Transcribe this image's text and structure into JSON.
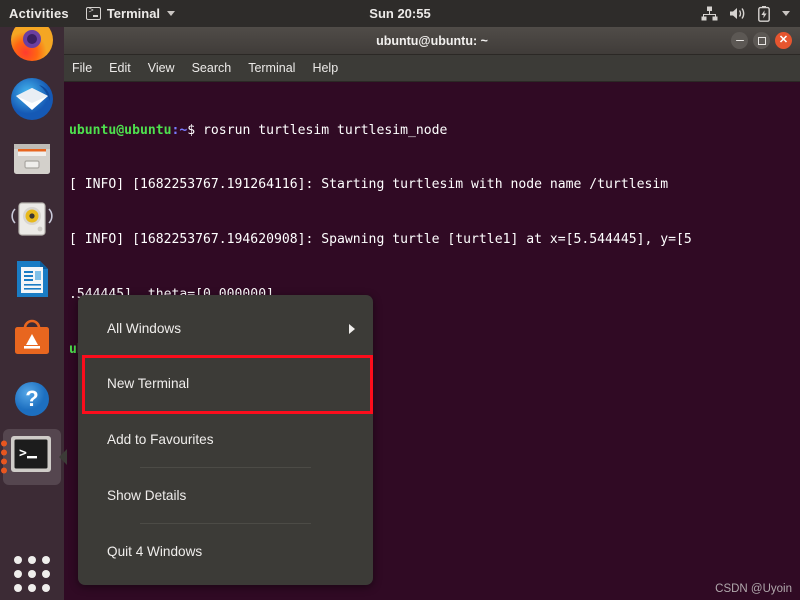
{
  "topbar": {
    "activities": "Activities",
    "app_icon": "terminal-icon",
    "app_name": "Terminal",
    "chevron": "chevron-down-icon",
    "clock": "Sun 20:55",
    "indicators": [
      "network-icon",
      "volume-icon",
      "battery-icon",
      "chevron-down-icon"
    ]
  },
  "dock": {
    "items": [
      {
        "name": "firefox",
        "label": "Firefox"
      },
      {
        "name": "thunderbird",
        "label": "Thunderbird Mail"
      },
      {
        "name": "files",
        "label": "Files"
      },
      {
        "name": "rhythmbox",
        "label": "Rhythmbox"
      },
      {
        "name": "libreoffice-writer",
        "label": "LibreOffice Writer"
      },
      {
        "name": "ubuntu-software",
        "label": "Ubuntu Software"
      },
      {
        "name": "help",
        "label": "Help"
      },
      {
        "name": "terminal",
        "label": "Terminal",
        "running": true,
        "window_count": 4,
        "selected": true
      }
    ],
    "show_applications": "Show Applications"
  },
  "window": {
    "title": "ubuntu@ubuntu: ~",
    "controls": {
      "minimize": "minimize-button",
      "maximize": "maximize-button",
      "close": "close-button"
    },
    "menubar": [
      "File",
      "Edit",
      "View",
      "Search",
      "Terminal",
      "Help"
    ],
    "terminal": {
      "prompt_user": "ubuntu@ubuntu",
      "prompt_path": ":~",
      "prompt_symbol": "$",
      "command": " rosrun turtlesim turtlesim_node",
      "lines": [
        "[ INFO] [1682253767.191264116]: Starting turtlesim with node name /turtlesim",
        "[ INFO] [1682253767.194620908]: Spawning turtle [turtle1] at x=[5.544445], y=[5",
        ".544445], theta=[0.000000]"
      ]
    }
  },
  "context_menu": {
    "items": [
      {
        "label": "All Windows",
        "has_submenu": true
      },
      {
        "label": "New Terminal",
        "highlighted": true
      },
      {
        "label": "Add to Favourites"
      },
      {
        "label": "Show Details"
      },
      {
        "label": "Quit 4 Windows"
      }
    ]
  },
  "highlight": {
    "color": "#fc0d1c"
  },
  "watermark": "CSDN @Uyoin",
  "colors": {
    "terminal_bg": "#300a24",
    "menu_bg": "#3c3b37",
    "topbar_bg": "#2e2c2a",
    "accent_orange": "#e8561f"
  }
}
